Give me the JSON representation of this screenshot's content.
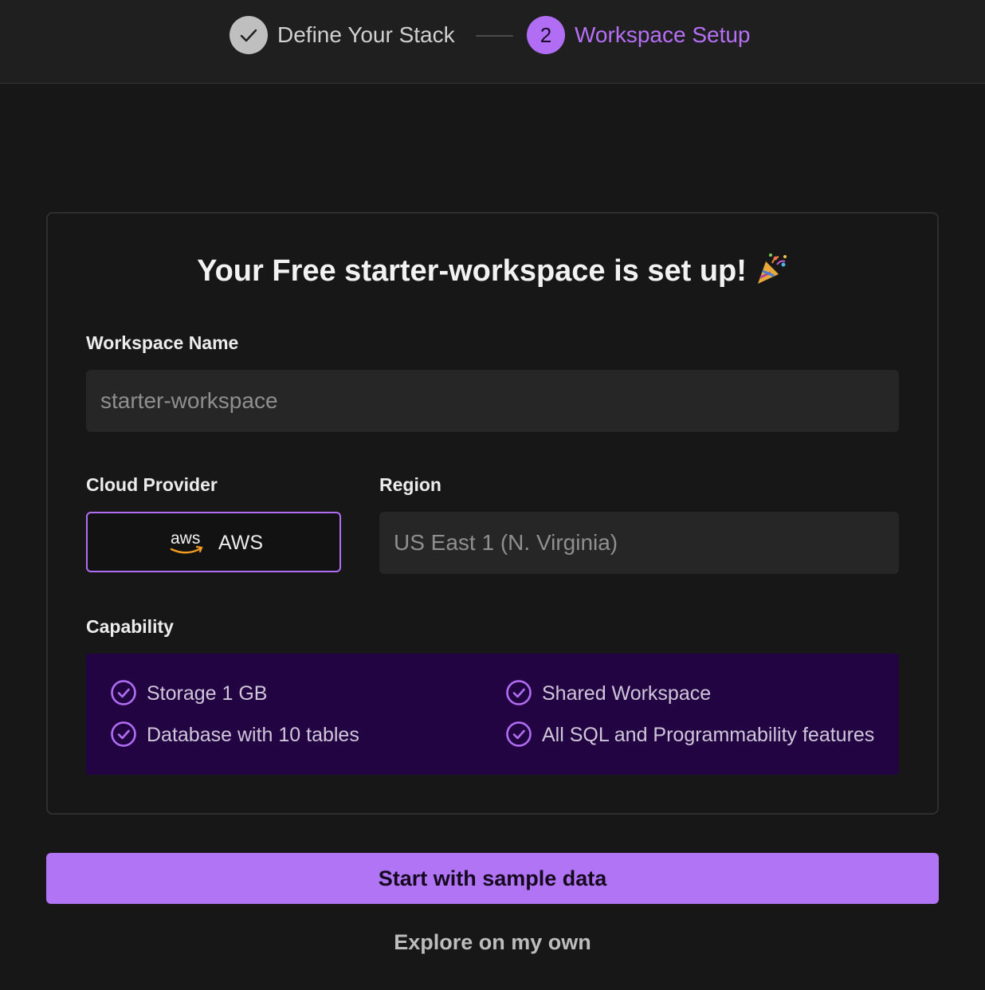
{
  "stepper": {
    "step1": {
      "label": "Define Your Stack",
      "state": "completed",
      "icon": "check-icon"
    },
    "step2": {
      "number": "2",
      "label": "Workspace Setup",
      "state": "active"
    }
  },
  "card": {
    "title": "Your Free starter-workspace is set up!",
    "title_icon": "party-popper-icon",
    "workspace_name": {
      "label": "Workspace Name",
      "value": "starter-workspace"
    },
    "cloud_provider": {
      "label": "Cloud Provider",
      "logo_text": "aws",
      "value": "AWS",
      "selected": true
    },
    "region": {
      "label": "Region",
      "value": "US East 1 (N. Virginia)"
    },
    "capability": {
      "label": "Capability",
      "items": [
        {
          "text": "Storage 1 GB",
          "icon": "check-circle-icon"
        },
        {
          "text": "Database with 10 tables",
          "icon": "check-circle-icon"
        },
        {
          "text": "Shared Workspace",
          "icon": "check-circle-icon"
        },
        {
          "text": "All SQL and Programmability features",
          "icon": "check-circle-icon"
        }
      ]
    }
  },
  "actions": {
    "primary": "Start with sample data",
    "secondary": "Explore on my own"
  },
  "colors": {
    "accent": "#b16ef5",
    "background": "#171717",
    "capability_bg": "#230443",
    "completed_step": "#bfbfbf"
  }
}
